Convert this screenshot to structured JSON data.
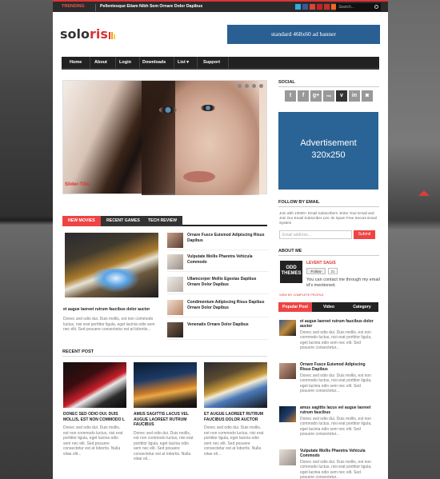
{
  "colors": {
    "accent": "#e44",
    "dark": "#222",
    "ad_blue": "#2a6496"
  },
  "topbar": {
    "trending_label": "TRENDING",
    "trending_text": "Pellentesque Etiam Nibh Sem Ornare Dolor Dapibus",
    "social_icons": [
      "twitter-icon",
      "facebook-icon",
      "google-plus-icon",
      "pinterest-icon",
      "youtube-icon",
      "rss-icon"
    ],
    "search_placeholder": "Search..."
  },
  "header": {
    "logo_part1": "solo",
    "logo_part2": "ris",
    "ad_text": "standard 468x60 ad banner"
  },
  "nav": {
    "items": [
      "Home",
      "About",
      "Login",
      "Downloads",
      "List ▾",
      "Support"
    ]
  },
  "slider": {
    "caption": "Slider-Title"
  },
  "tabs": {
    "items": [
      "NEW MOVIES",
      "RECENT GAMES",
      "TECH REVIEW"
    ]
  },
  "featured": {
    "title": "et augue laoreet rutrum faucibus dolor auctor",
    "desc": "Donec sed odio dui. Duis mollis, est non commodo luctus, nisi erat porttitor ligula, eget lacinia odio sem nec elit. Sed posuere consectetur est at lobortis..."
  },
  "side_list": [
    "Ornare Fusce Euismod Adipiscing Risus Dapibus",
    "Vulputate Mollis Pharetra Vehicula Commodo",
    "Ullamcorper Mollis Egestas Dapibus Ornare Dolor Dapibus",
    "Condimentum Adipiscing Risus Dapibus Ornare Dolor Dapibus",
    "Venenatis Ornare Dolor Dapibus"
  ],
  "recent": {
    "heading": "RECENT POST",
    "posts": [
      {
        "title": "DONEC SED ODIO DUI. DUIS MOLLIS, EST NON COMMODO L",
        "desc": "Donec sed odio dui. Duis mollis, est non commodo luctus, nisi erat porttitor ligula, eget lacinia odio sem nec elit. Sed posuere consectetur est at lobortis. Nulla vitae elit..."
      },
      {
        "title": "AMUS SAGITTIS LACUS VEL AUGUE LAOREET RUTRUM FAUCIBUS",
        "desc": "Donec sed odio dui. Duis mollis, est non commodo luctus, nisi erat porttitor ligula, eget lacinia odio sem nec elit. Sed posuere consectetur est at lobortis. Nulla vitae eli..."
      },
      {
        "title": "ET AUGUE LAOREET RUTRUM FAUCIBUS DOLOR AUCTOR",
        "desc": "Donec sed odio dui. Duis mollis, est non commodo luctus, nisi erat porttitor ligula, eget lacinia odio sem nec elit. Sed posuere consectetur est at lobortis. Nulla vitae eli..."
      }
    ]
  },
  "sidebar": {
    "social_heading": "SOCIAL",
    "social_icons": [
      "twitter-icon",
      "facebook-icon",
      "google-plus-icon",
      "rss-icon",
      "vimeo-icon",
      "linkedin-icon",
      "instagram-icon"
    ],
    "social_glyphs": [
      "t",
      "f",
      "g+",
      "rss",
      "v",
      "in",
      "◙"
    ],
    "ad_line1": "Advertisement",
    "ad_line2": "320x250",
    "follow_heading": "FOLLOW BY EMAIL",
    "follow_text": "Join with 10000+ Email Subscribers. Enter Your Email and Join Our Email Subscriber List. Its Spam Free Secure Email System",
    "email_placeholder": "Email address...",
    "submit_label": "Submit",
    "about_heading": "ABOUT ME",
    "odd_line1": "ODD",
    "odd_line2": "THEMES",
    "profile_name": "LEVENT SAGIS",
    "follow_label": "Follow",
    "follow_count": "21",
    "about_text": "You can contact me through my email id's mentioned.",
    "profile_link": "VIEW MY COMPLETE PROFILE",
    "tabs": [
      "Popular Post",
      "Video",
      "Category"
    ],
    "posts": [
      {
        "title": "et augue laoreet rutrum faucibus dolor auctor",
        "desc": "Donec sed odio dui. Duis mollis, est non commodo luctus, nisi erat porttitor ligula, eget lacinia odio sem nec elit. Sed posuere consectetur..."
      },
      {
        "title": "Ornare Fusce Euismod Adipiscing Risus Dapibus",
        "desc": "Donec sed odio dui. Duis mollis, est non commodo luctus, nisi erat porttitor ligula, eget lacinia odio sem nec elit. Sed posuere consectetur..."
      },
      {
        "title": "amus sagittis lacus vel augue laoreet rutrum faucibus",
        "desc": "Donec sed odio dui. Duis mollis, est non commodo luctus, nisi erat porttitor ligula, eget lacinia odio sem nec elit. Sed posuere consectetur..."
      },
      {
        "title": "Vulputate Mollis Pharetra Vehicula Commodo",
        "desc": "Donec sed odio dui. Duis mollis, est non commodo luctus, nisi erat porttitor ligula, eget lacinia odio sem nec elit. Sed posuere consectetur..."
      }
    ]
  }
}
